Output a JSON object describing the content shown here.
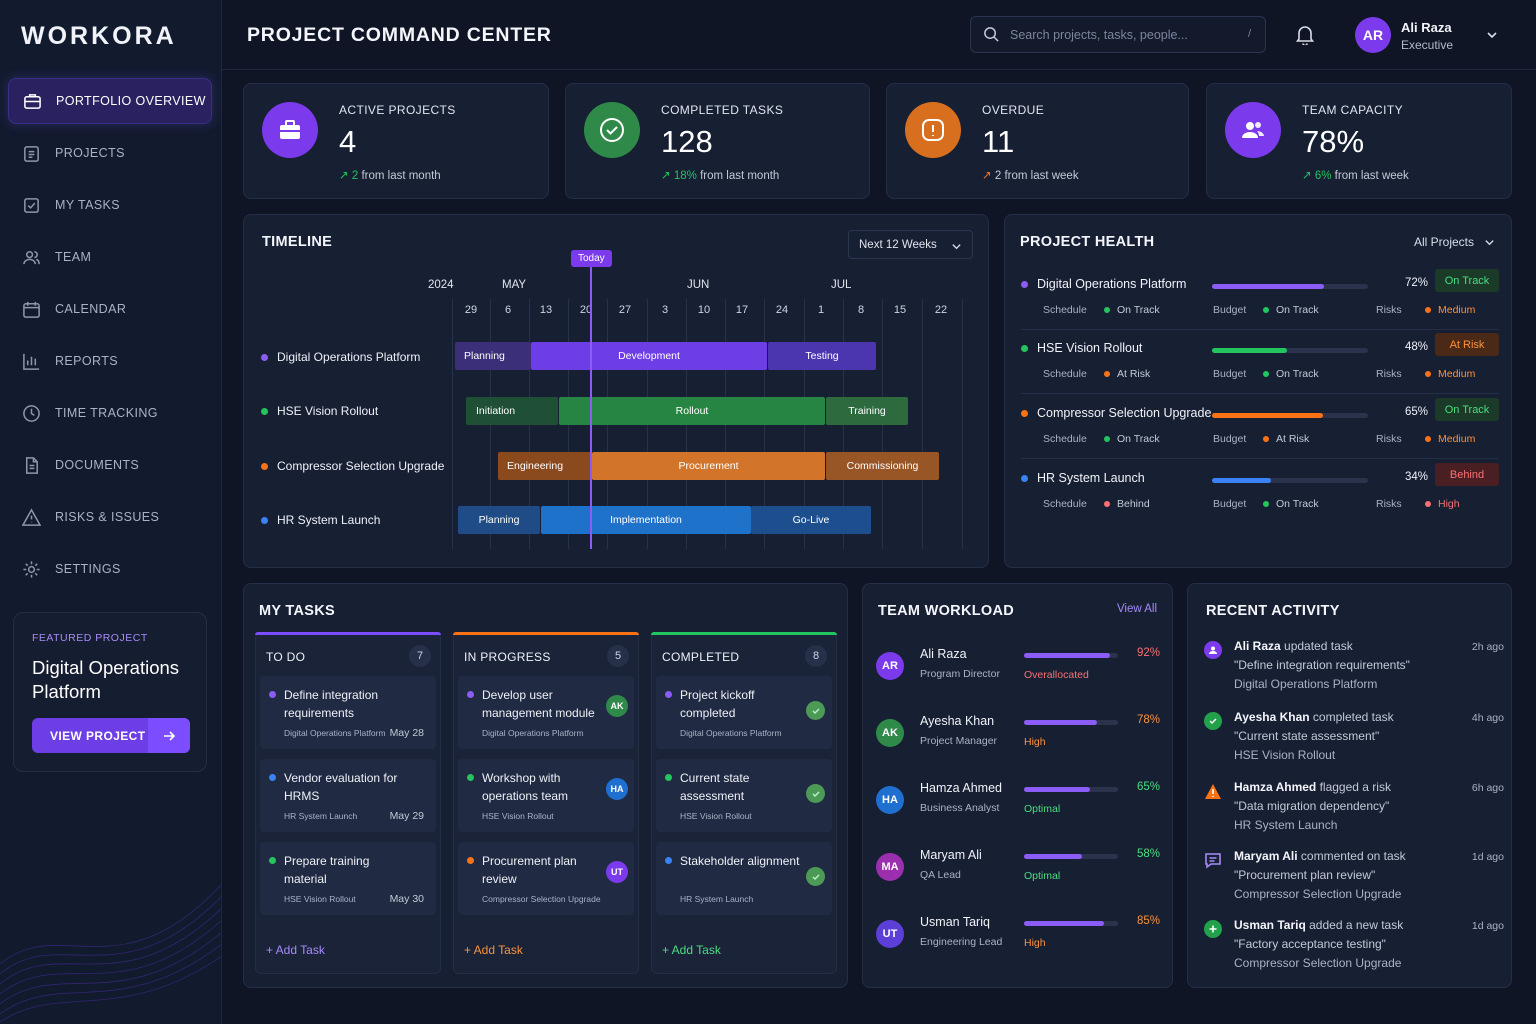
{
  "brand": "WORKORA",
  "page_title": "PROJECT COMMAND CENTER",
  "search": {
    "placeholder": "Search projects, tasks, people...",
    "shortcut": "/"
  },
  "user": {
    "initials": "AR",
    "name": "Ali Raza",
    "role": "Executive"
  },
  "nav": [
    {
      "label": "PORTFOLIO OVERVIEW",
      "icon": "briefcase-icon",
      "active": true
    },
    {
      "label": "PROJECTS",
      "icon": "clipboard-icon"
    },
    {
      "label": "MY TASKS",
      "icon": "checkbox-icon"
    },
    {
      "label": "TEAM",
      "icon": "users-icon"
    },
    {
      "label": "CALENDAR",
      "icon": "calendar-icon"
    },
    {
      "label": "REPORTS",
      "icon": "bar-chart-icon"
    },
    {
      "label": "TIME TRACKING",
      "icon": "clock-icon"
    },
    {
      "label": "DOCUMENTS",
      "icon": "document-icon"
    },
    {
      "label": "RISKS & ISSUES",
      "icon": "warning-icon"
    },
    {
      "label": "SETTINGS",
      "icon": "gear-icon"
    }
  ],
  "featured": {
    "label": "FEATURED PROJECT",
    "title": "Digital Operations Platform",
    "button": "VIEW PROJECT"
  },
  "kpis": [
    {
      "label": "ACTIVE PROJECTS",
      "value": "4",
      "change_value": "2",
      "change_text": " from last month",
      "trend": "up",
      "color": "#7c3aed",
      "icon": "briefcase-icon"
    },
    {
      "label": "COMPLETED TASKS",
      "value": "128",
      "change_value": "18%",
      "change_text": " from last month",
      "trend": "up",
      "color": "#2f8a4a",
      "icon": "check-circle-icon"
    },
    {
      "label": "OVERDUE",
      "value": "11",
      "change_value": "2",
      "change_text": " from last week",
      "trend": "up-bad",
      "color": "#d86f1e",
      "icon": "alert-icon"
    },
    {
      "label": "TEAM CAPACITY",
      "value": "78%",
      "change_value": "6%",
      "change_text": " from last week",
      "trend": "up",
      "color": "#7c3aed",
      "icon": "team-icon"
    }
  ],
  "timeline": {
    "title": "TIMELINE",
    "range": "Next 12 Weeks",
    "today_label": "Today",
    "year": "2024",
    "months": [
      "MAY",
      "JUN",
      "JUL"
    ],
    "days": [
      "29",
      "6",
      "13",
      "20",
      "27",
      "3",
      "10",
      "17",
      "24",
      "1",
      "8",
      "15",
      "22"
    ],
    "rows": [
      {
        "name": "Digital Operations Platform",
        "color": "#8b5cf6",
        "phases": [
          "Planning",
          "Development",
          "Testing"
        ]
      },
      {
        "name": "HSE Vision Rollout",
        "color": "#22c55e",
        "phases": [
          "Initiation",
          "Rollout",
          "Training"
        ]
      },
      {
        "name": "Compressor Selection Upgrade",
        "color": "#f97316",
        "phases": [
          "Engineering",
          "Procurement",
          "Commissioning"
        ]
      },
      {
        "name": "HR System Launch",
        "color": "#3b82f6",
        "phases": [
          "Planning",
          "Implementation",
          "Go-Live"
        ]
      }
    ]
  },
  "health": {
    "title": "PROJECT HEALTH",
    "filter": "All Projects",
    "labels": {
      "schedule": "Schedule",
      "budget": "Budget",
      "risks": "Risks"
    },
    "projects": [
      {
        "name": "Digital Operations Platform",
        "progress": 72,
        "pct": "72%",
        "status": "On Track",
        "color": "#8b5cf6",
        "schedule": "On Track",
        "budget": "On Track",
        "risks": "Medium"
      },
      {
        "name": "HSE Vision Rollout",
        "progress": 48,
        "pct": "48%",
        "status": "At Risk",
        "color": "#22c55e",
        "schedule": "At Risk",
        "budget": "On Track",
        "risks": "Medium"
      },
      {
        "name": "Compressor Selection Upgrade",
        "progress": 65,
        "pct": "65%",
        "status": "On Track",
        "color": "#f97316",
        "schedule": "On Track",
        "budget": "At Risk",
        "risks": "Medium"
      },
      {
        "name": "HR System Launch",
        "progress": 34,
        "pct": "34%",
        "status": "Behind",
        "color": "#3b82f6",
        "schedule": "Behind",
        "budget": "On Track",
        "risks": "High"
      }
    ]
  },
  "tasks": {
    "title": "MY TASKS",
    "add_label": "+ Add Task",
    "columns": [
      {
        "name": "TO DO",
        "count": "7",
        "items": [
          {
            "title": "Define integration requirements",
            "project": "Digital Operations Platform",
            "date": "May 28"
          },
          {
            "title": "Vendor evaluation for HRMS",
            "project": "HR System Launch",
            "date": "May 29"
          },
          {
            "title": "Prepare training material",
            "project": "HSE Vision Rollout",
            "date": "May 30"
          }
        ]
      },
      {
        "name": "IN PROGRESS",
        "count": "5",
        "items": [
          {
            "title": "Develop user management module",
            "project": "Digital Operations Platform",
            "assignee": "AK"
          },
          {
            "title": "Workshop with operations team",
            "project": "HSE Vision Rollout",
            "assignee": "HA"
          },
          {
            "title": "Procurement plan review",
            "project": "Compressor Selection Upgrade",
            "assignee": "UT"
          }
        ]
      },
      {
        "name": "COMPLETED",
        "count": "8",
        "items": [
          {
            "title": "Project kickoff completed",
            "project": "Digital Operations Platform"
          },
          {
            "title": "Current state assessment",
            "project": "HSE Vision Rollout"
          },
          {
            "title": "Stakeholder alignment",
            "project": "HR System Launch"
          }
        ]
      }
    ]
  },
  "workload": {
    "title": "TEAM WORKLOAD",
    "view_all": "View All",
    "members": [
      {
        "initials": "AR",
        "name": "Ali Raza",
        "role": "Program Director",
        "load": 92,
        "pct": "92%",
        "status": "Overallocated",
        "avatar_color": "#7c3aed"
      },
      {
        "initials": "AK",
        "name": "Ayesha Khan",
        "role": "Project Manager",
        "load": 78,
        "pct": "78%",
        "status": "High",
        "avatar_color": "#2f8a4a"
      },
      {
        "initials": "HA",
        "name": "Hamza Ahmed",
        "role": "Business Analyst",
        "load": 65,
        "pct": "65%",
        "status": "Optimal",
        "avatar_color": "#1f6fd1"
      },
      {
        "initials": "MA",
        "name": "Maryam Ali",
        "role": "QA Lead",
        "load": 58,
        "pct": "58%",
        "status": "Optimal",
        "avatar_color": "#9b2fae"
      },
      {
        "initials": "UT",
        "name": "Usman Tariq",
        "role": "Engineering Lead",
        "load": 85,
        "pct": "85%",
        "status": "High",
        "avatar_color": "#5b3fd6"
      }
    ]
  },
  "activity": {
    "title": "RECENT ACTIVITY",
    "items": [
      {
        "user": "Ali Raza",
        "action": " updated task",
        "detail": "\"Define integration requirements\"",
        "project": "Digital Operations Platform",
        "time": "2h ago",
        "icon": "update-icon"
      },
      {
        "user": "Ayesha Khan",
        "action": " completed task",
        "detail": "\"Current state assessment\"",
        "project": "HSE Vision Rollout",
        "time": "4h ago",
        "icon": "check-icon"
      },
      {
        "user": "Hamza Ahmed",
        "action": " flagged a risk",
        "detail": "\"Data migration dependency\"",
        "project": "HR System Launch",
        "time": "6h ago",
        "icon": "warning-icon"
      },
      {
        "user": "Maryam Ali",
        "action": " commented on task",
        "detail": "\"Procurement plan review\"",
        "project": "Compressor Selection Upgrade",
        "time": "1d ago",
        "icon": "comment-icon"
      },
      {
        "user": "Usman Tariq",
        "action": " added a new task",
        "detail": "\"Factory acceptance testing\"",
        "project": "Compressor Selection Upgrade",
        "time": "1d ago",
        "icon": "plus-icon"
      }
    ]
  }
}
